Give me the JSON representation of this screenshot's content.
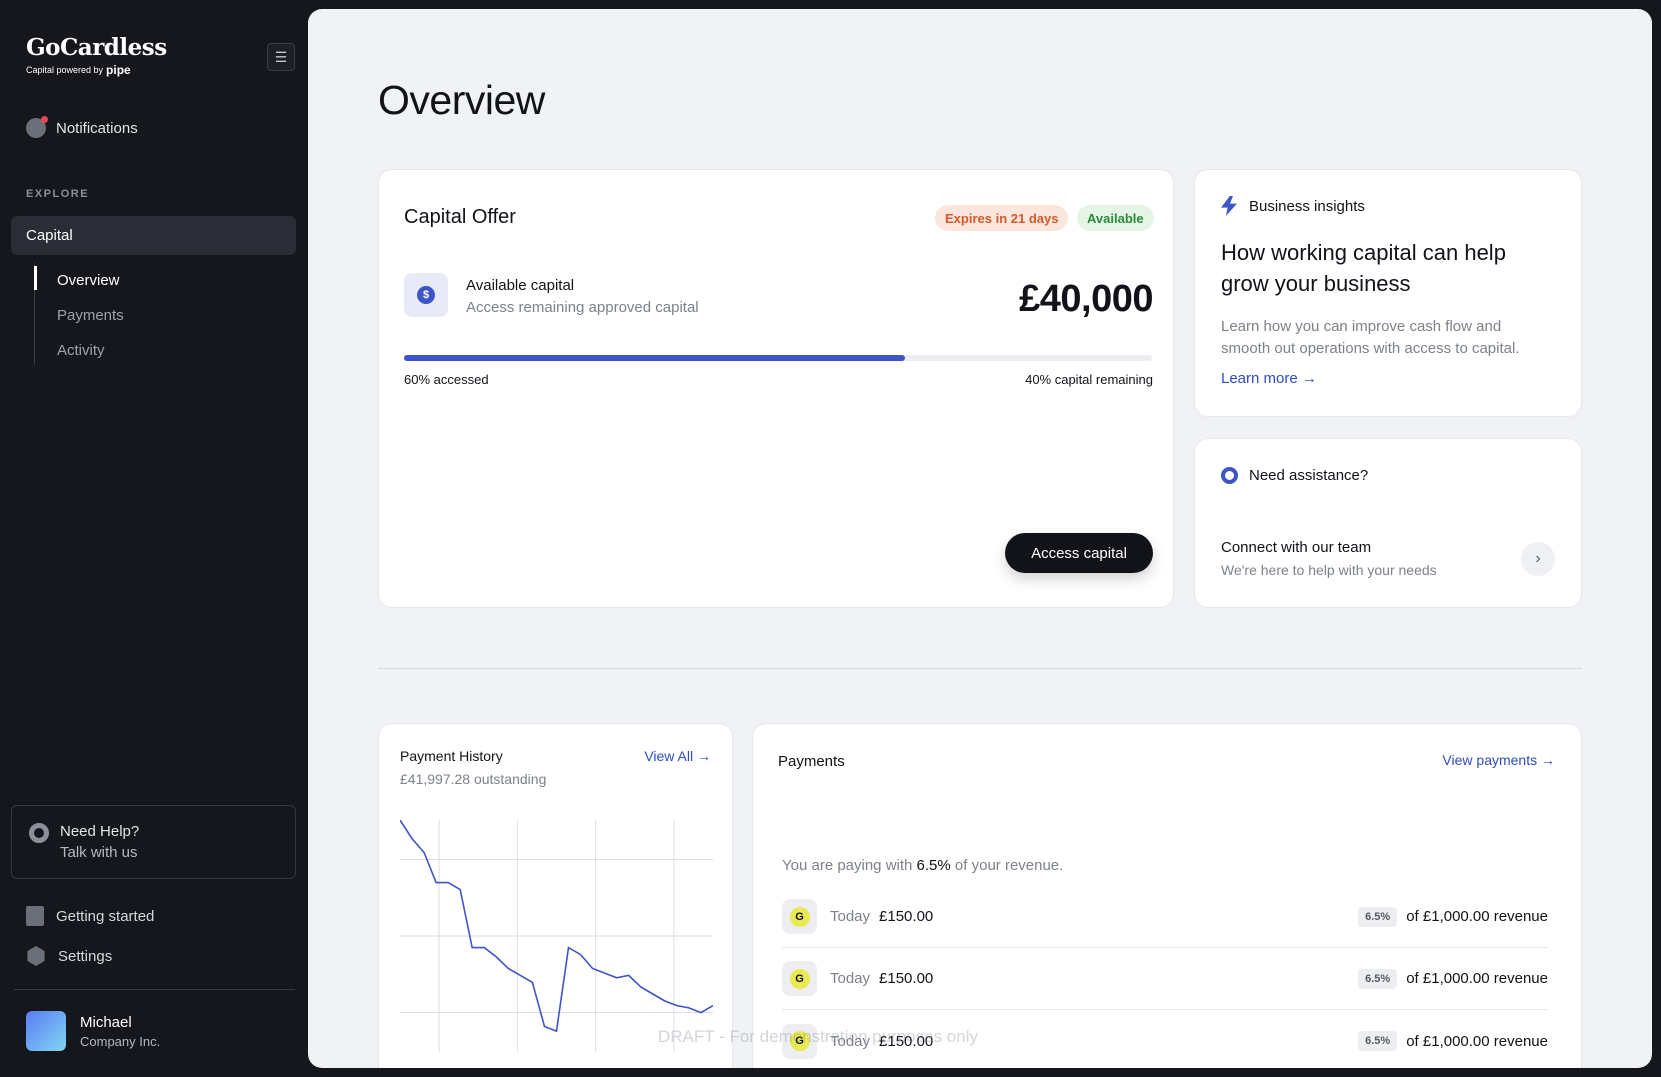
{
  "sidebar": {
    "logo": {
      "name": "GoCardless",
      "sub_prefix": "Capital powered by",
      "sub_brand": "pipe"
    },
    "notifications_label": "Notifications",
    "section_label": "EXPLORE",
    "capital_label": "Capital",
    "subnav": [
      "Overview",
      "Payments",
      "Activity"
    ],
    "help": {
      "title": "Need Help?",
      "subtitle": "Talk with us"
    },
    "getting_started_label": "Getting started",
    "settings_label": "Settings",
    "user": {
      "name": "Michael",
      "company": "Company Inc."
    }
  },
  "main": {
    "title": "Overview",
    "offer": {
      "title": "Capital Offer",
      "badge_expires": "Expires in 21 days",
      "badge_status": "Available",
      "available_label": "Available capital",
      "available_desc": "Access remaining approved capital",
      "amount": "£40,000",
      "progress_fraction": 0.67,
      "accessed_label": "60% accessed",
      "remaining_label": "40% capital remaining",
      "button": "Access capital"
    },
    "insights": {
      "tag": "Business insights",
      "title": "How working capital can help grow your business",
      "description": "Learn how you can improve cash flow and smooth out operations with access to capital.",
      "link": "Learn more →"
    },
    "assist": {
      "title": "Need assistance?",
      "heading": "Connect with our team",
      "subtitle": "We're here to help with your needs"
    },
    "history": {
      "title": "Payment History",
      "outstanding": "£41,997.28 outstanding",
      "link": "View All →"
    },
    "payments": {
      "title": "Payments",
      "link": "View payments →",
      "note_prefix": "You are paying with",
      "note_rate": "6.5%",
      "note_suffix": "of your revenue.",
      "rows": [
        {
          "day": "Today",
          "amount": "£150.00",
          "pct": "6.5%",
          "revenue": "of £1,000.00 revenue"
        },
        {
          "day": "Today",
          "amount": "£150.00",
          "pct": "6.5%",
          "revenue": "of £1,000.00 revenue"
        },
        {
          "day": "Today",
          "amount": "£150.00",
          "pct": "6.5%",
          "revenue": "of £1,000.00 revenue"
        }
      ]
    },
    "watermark": "DRAFT - For demonstration purposes only"
  },
  "colors": {
    "accent": "#3d55c7",
    "sidebar_bg": "#15171c",
    "main_bg": "#f1f2f5",
    "expires": "#d4582b",
    "available": "#2a8a3a"
  },
  "chart_data": {
    "type": "line",
    "title": "",
    "xlabel": "",
    "ylabel": "",
    "grid": true,
    "x": [
      0,
      1,
      2,
      3,
      4,
      5,
      6,
      7,
      8,
      9,
      10,
      11,
      12,
      13,
      14,
      15,
      16,
      17,
      18,
      19,
      20,
      21,
      22,
      23,
      24,
      25,
      26
    ],
    "series": [
      {
        "values": [
          100,
          92,
          86,
          73,
          73,
          70,
          45,
          45,
          41,
          36,
          33,
          30,
          11,
          9,
          45,
          42,
          36,
          34,
          32,
          33,
          28,
          25,
          22,
          20,
          19,
          17,
          20
        ]
      }
    ],
    "ylim": [
      0,
      100
    ]
  }
}
